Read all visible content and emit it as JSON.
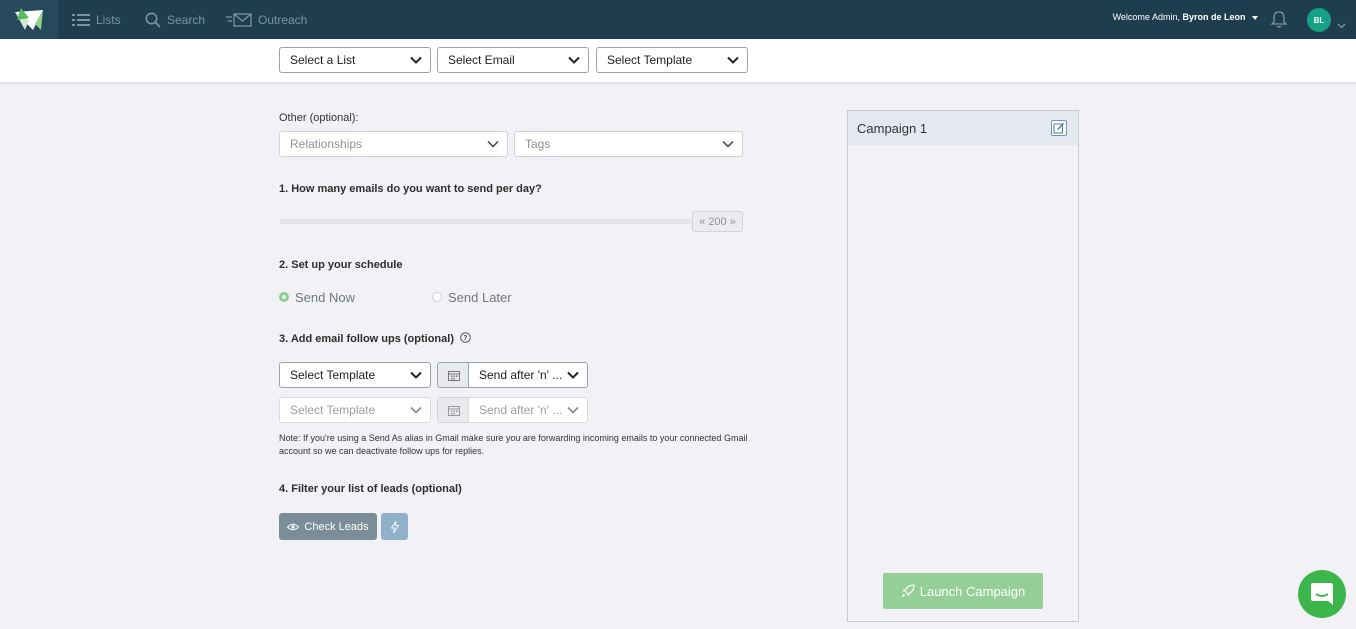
{
  "nav": {
    "items": [
      {
        "label": "Lists",
        "icon": "list-icon"
      },
      {
        "label": "Search",
        "icon": "search-icon"
      },
      {
        "label": "Outreach",
        "icon": "outreach-mail-icon"
      }
    ],
    "welcome_prefix": "Welcome Admin,",
    "user_name": "Byron de Leon",
    "avatar_initials": "BL",
    "bar_color": "#1e3d4f"
  },
  "top_selects": {
    "list": "Select a List",
    "email": "Select Email",
    "template": "Select Template"
  },
  "other": {
    "label": "Other (optional):",
    "relationships": "Relationships",
    "tags": "Tags"
  },
  "step1": {
    "label": "1. How many emails do you want to send per day?",
    "slider_value": "200",
    "slider_fraction": 1.0
  },
  "step2": {
    "label": "2. Set up your schedule",
    "option_now": "Send Now",
    "option_later": "Send Later",
    "selected": "Send Now"
  },
  "step3": {
    "label": "3. Add email follow ups (optional)",
    "followups": [
      {
        "template": "Select Template",
        "send_after": "Send after 'n' ..."
      },
      {
        "template": "Select Template",
        "send_after": "Send after 'n' ..."
      }
    ],
    "note": "Note: If you're using a Send As alias in Gmail make sure you are forwarding incoming emails to your connected Gmail account so we can deactivate follow ups for replies."
  },
  "step4": {
    "label": "4. Filter your list of leads (optional)",
    "check_leads": "Check Leads"
  },
  "campaign": {
    "title": "Campaign 1",
    "launch_label": "Launch Campaign",
    "launch_color": "#94d096"
  }
}
